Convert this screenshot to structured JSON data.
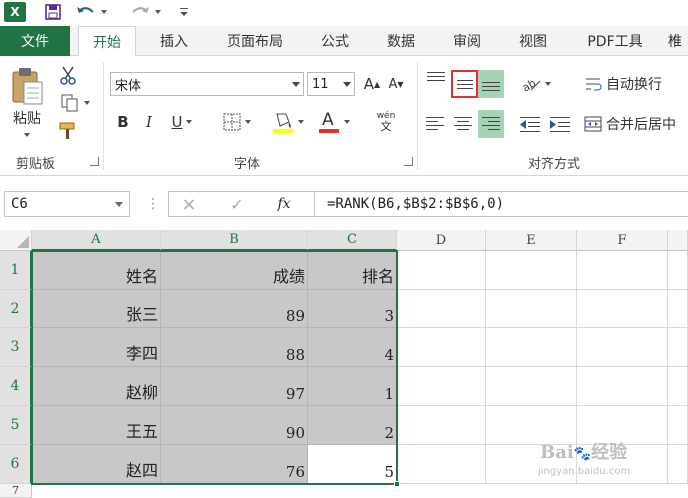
{
  "qat": {
    "logo_text": "X",
    "icons": [
      "excel-logo",
      "save-icon",
      "undo-icon",
      "redo-icon",
      "customize-icon"
    ]
  },
  "tabs": [
    {
      "label": "文件",
      "state": "file"
    },
    {
      "label": "开始",
      "state": "active"
    },
    {
      "label": "插入",
      "state": ""
    },
    {
      "label": "页面布局",
      "state": ""
    },
    {
      "label": "公式",
      "state": ""
    },
    {
      "label": "数据",
      "state": ""
    },
    {
      "label": "审阅",
      "state": ""
    },
    {
      "label": "视图",
      "state": ""
    },
    {
      "label": "PDF工具",
      "state": ""
    },
    {
      "label": "椎",
      "state": ""
    }
  ],
  "ribbon": {
    "clipboard": {
      "paste_label": "粘贴",
      "group_label": "剪贴板"
    },
    "font": {
      "font_name": "宋体",
      "font_size": "11",
      "grow_label": "A",
      "shrink_label": "A",
      "bold_label": "B",
      "italic_label": "I",
      "underline_label": "U",
      "font_color_label": "A",
      "phonetic_top": "wén",
      "phonetic_bottom": "文",
      "group_label": "字体"
    },
    "alignment": {
      "wrap_label": "自动换行",
      "merge_label": "合并后居中",
      "group_label": "对齐方式"
    },
    "colors": {
      "accent": "#217346",
      "highlight_box": "#e03030",
      "active_align": "#a6d3b6",
      "font_color_bar": "#e03030",
      "fill_color_bar": "#ffff00"
    }
  },
  "formula_bar": {
    "name_box": "C6",
    "cancel_icon": "×",
    "enter_icon": "✓",
    "fx_label": "fx",
    "formula": "=RANK(B6,$B$2:$B$6,0)"
  },
  "sheet": {
    "columns": [
      "A",
      "B",
      "C",
      "D",
      "E",
      "F"
    ],
    "rows": [
      "1",
      "2",
      "3",
      "4",
      "5",
      "6",
      "7"
    ],
    "cells": [
      [
        "姓名",
        "成绩",
        "排名"
      ],
      [
        "张三",
        "89",
        "3"
      ],
      [
        "李四",
        "88",
        "4"
      ],
      [
        "赵柳",
        "97",
        "1"
      ],
      [
        "王五",
        "90",
        "2"
      ],
      [
        "赵四",
        "76",
        "5"
      ]
    ]
  },
  "watermark": {
    "brand": "Bai",
    "brand_cn": "经验",
    "url": "jingyan.baidu.com"
  }
}
